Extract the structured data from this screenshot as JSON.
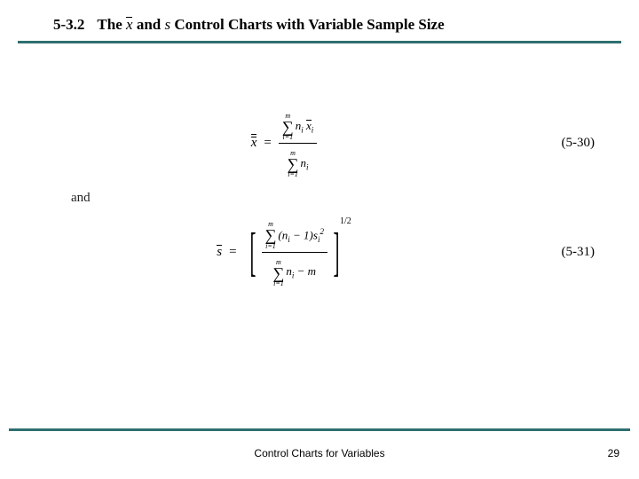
{
  "header": {
    "section_number": "5-3.2",
    "title_prefix": "The",
    "title_sym1": "x̄",
    "title_and": "and",
    "title_sym2": "s",
    "title_suffix": "Control Charts with Variable Sample Size"
  },
  "equations": {
    "eq1": {
      "lhs": "x",
      "eq_sign": "=",
      "sum_upper": "m",
      "sum_lower": "i=1",
      "num_term": "nᵢ x̄ᵢ",
      "den_sum_upper": "m",
      "den_sum_lower": "i=1",
      "den_term": "nᵢ",
      "label": "(5-30)"
    },
    "connective": "and",
    "eq2": {
      "lhs": "s",
      "eq_sign": "=",
      "sum_upper": "m",
      "sum_lower": "i=1",
      "num_term": "(nᵢ − 1)sᵢ²",
      "den_sum_upper": "m",
      "den_sum_lower": "i=1",
      "den_term": "nᵢ − m",
      "exponent": "1/2",
      "label": "(5-31)"
    }
  },
  "footer": {
    "caption": "Control Charts for Variables",
    "page": "29"
  }
}
